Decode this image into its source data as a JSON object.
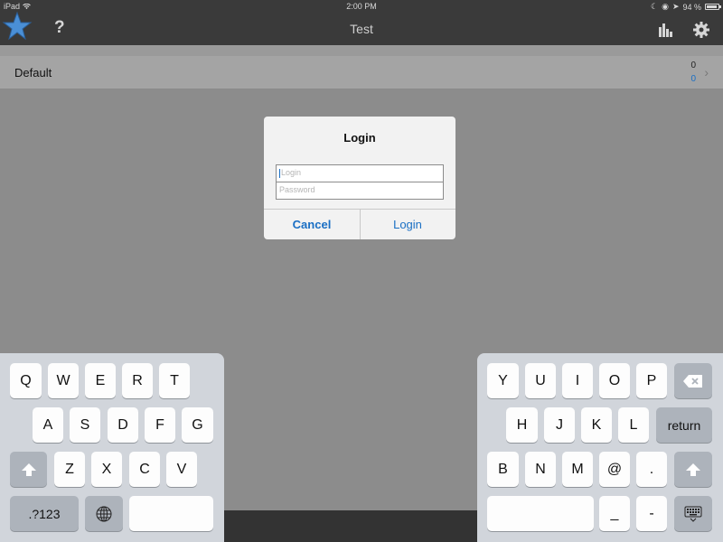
{
  "status_bar": {
    "device": "iPad",
    "time": "2:00 PM",
    "battery_percent": "94 %",
    "battery_level": 0.94
  },
  "nav": {
    "title": "Test",
    "help_label": "?"
  },
  "list": {
    "row_label": "Default",
    "count_top": "0",
    "count_bottom": "0"
  },
  "dialog": {
    "title": "Login",
    "login_placeholder": "Login",
    "password_placeholder": "Password",
    "cancel_label": "Cancel",
    "login_label": "Login"
  },
  "keyboard_left": {
    "row1": [
      "Q",
      "W",
      "E",
      "R",
      "T"
    ],
    "row2": [
      "A",
      "S",
      "D",
      "F",
      "G"
    ],
    "row3": [
      "Z",
      "X",
      "C",
      "V"
    ],
    "numbers_label": ".?123"
  },
  "keyboard_right": {
    "row1": [
      "Y",
      "U",
      "I",
      "O",
      "P"
    ],
    "row2": [
      "H",
      "J",
      "K",
      "L"
    ],
    "return_label": "return",
    "row3": [
      "B",
      "N",
      "M",
      "@",
      "."
    ],
    "row4": [
      "_",
      "-"
    ]
  },
  "colors": {
    "accent": "#1a6fc4",
    "bar": "#3a3a3a",
    "keyboard": "#d1d5db"
  }
}
